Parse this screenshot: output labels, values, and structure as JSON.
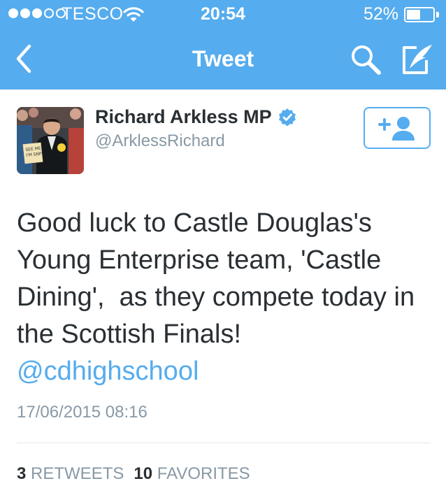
{
  "status_bar": {
    "carrier": "TESCO",
    "time": "20:54",
    "battery_percent": "52%",
    "battery_level": 0.52,
    "signal_bars_filled": 3,
    "signal_bars_total": 5
  },
  "nav": {
    "title": "Tweet",
    "icons": [
      "back-chevron-icon",
      "search-icon",
      "compose-tweet-icon"
    ]
  },
  "author": {
    "name": "Richard Arkless MP",
    "handle": "@ArklessRichard",
    "verified": true,
    "avatar_sign_text": [
      "SEE ME",
      "I'M SNP"
    ]
  },
  "follow_button": {
    "icon": "add-user-icon"
  },
  "tweet": {
    "text_lines": [
      "Good luck to Castle Douglas's",
      "Young Enterprise team, 'Castle",
      "Dining',  as they compete today in",
      "the Scottish Finals!"
    ],
    "mention": "@cdhighschool",
    "timestamp": "17/06/2015 08:16"
  },
  "stats": {
    "retweets_count": "3",
    "retweets_label": "RETWEETS",
    "favorites_count": "10",
    "favorites_label": "FAVORITES"
  },
  "colors": {
    "brand_blue": "#55acee",
    "text_dark": "#292f33",
    "text_muted": "#8899a6",
    "divider": "#e1e8ed"
  }
}
